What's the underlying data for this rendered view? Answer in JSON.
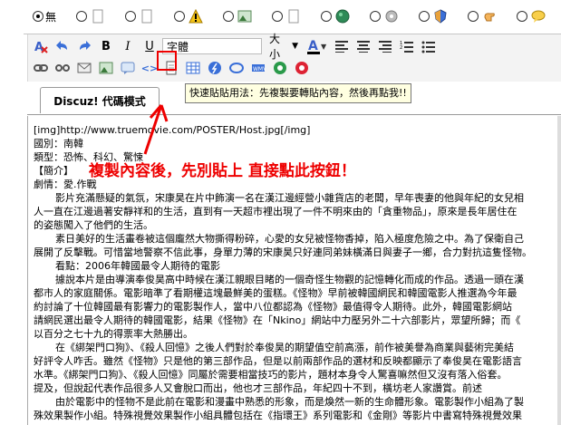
{
  "smilies": {
    "none_label": "無"
  },
  "toolbar": {
    "font_label": "字體",
    "size_label": "大小"
  },
  "tab": {
    "label": "Discuz! 代碼模式"
  },
  "tooltip": {
    "text": "快速貼貼用法：先複製要轉貼內容，然後再點我!!"
  },
  "annotation": {
    "text": "複製內容後，先別貼上  直接點此按鈕！",
    "color": "#e00000"
  },
  "editor": {
    "lines": [
      {
        "text": "[img]http://www.truemovie.com/POSTER/Host.jpg[/img]",
        "indent": false
      },
      {
        "text": "國別：南韓",
        "indent": false
      },
      {
        "text": "類型：恐怖、科幻、驚悚",
        "indent": false
      },
      {
        "text": "【簡介】",
        "indent": false
      },
      {
        "text": "劇情：愛.作戰",
        "indent": false
      },
      {
        "text": "影片充滿懸疑的氣氛，宋康昊在片中飾演一名在漢江邊經營小雜貨店的老闆，早年喪妻的他與年紀的女兒相",
        "indent": true
      },
      {
        "text": "人一直在江邊過著安靜祥和的生活，直到有一天超市裡出現了一件不明來由的「貪重物品」，原來是長年居住在",
        "indent": false
      },
      {
        "text": "的姿態闖入了他們的生活。",
        "indent": false
      },
      {
        "text": "素日美好的生活畫卷被這個龐然大物撕得粉碎，心愛的女兒被怪物香掉，陷入極度危險之中。為了保衛自己",
        "indent": true
      },
      {
        "text": "展開了反擊戰。可惜當地警察不信此事，身單力薄的宋康昊只好連同弟妹橫滿日與妻子一鄉，合力對抗這隻怪物。",
        "indent": false
      },
      {
        "text": "看點：2006年韓國最令人期待的電影",
        "indent": true
      },
      {
        "text": "據說本片是由導演奉俊昊高中時候在漢江親眼目睹的一個奇怪生物觀的記憶轉化而成的作品。透過一頭在漢",
        "indent": true
      },
      {
        "text": "都市人的家庭關係。電影暗準了看期權這塊最鮮美的蛋糕。《怪物》早前被韓國網民和韓國電影人推選為今年最",
        "indent": false
      },
      {
        "text": "約討論了十位韓國最有影響力的電影製作人，當中八位都認為《怪物》最值得令人期待。此外，韓國電影網站",
        "indent": false
      },
      {
        "text": "請網民選出最令人期待的韓國電影，結果《怪物》在「Nkino」網站中力壓另外二十六部影片，眾望所歸；而《",
        "indent": false
      },
      {
        "text": "以百分之七十九的得票率大熱勝出。",
        "indent": false
      },
      {
        "text": "在《綁架門口狗》、《殺人回憶》之後人們對於奉俊昊的期望值空前高漲，前作被美譽為商業與藝術完美結",
        "indent": true
      },
      {
        "text": "好評令人咋舌。雖然《怪物》只是他的第三部作品，但是以前兩部作品的選材和反映都顯示了奉俊昊在電影語言",
        "indent": false
      },
      {
        "text": "水準。《綁架門口狗》、《殺人回憶》同屬於需要相當技巧的影片，題材本身令人驚喜嘛然但又沒有落入俗套。",
        "indent": false
      },
      {
        "text": "提及，但說起代表作品很多人又會脫口而出，他也才三部作品，年紀四十不到，橫坊老人家讚賞。前述",
        "indent": false
      },
      {
        "text": "由於電影中的怪物不是此前在電影和漫畫中熟悉的形象，而是煥然一新的生命體形象。電影製作小組為了製",
        "indent": true
      },
      {
        "text": "殊效果製作小組。特殊視覺效果製作小組具體包括在《指環王》系列電影和《金剛》等影片中書寫特殊視覺效果",
        "indent": false
      }
    ]
  }
}
